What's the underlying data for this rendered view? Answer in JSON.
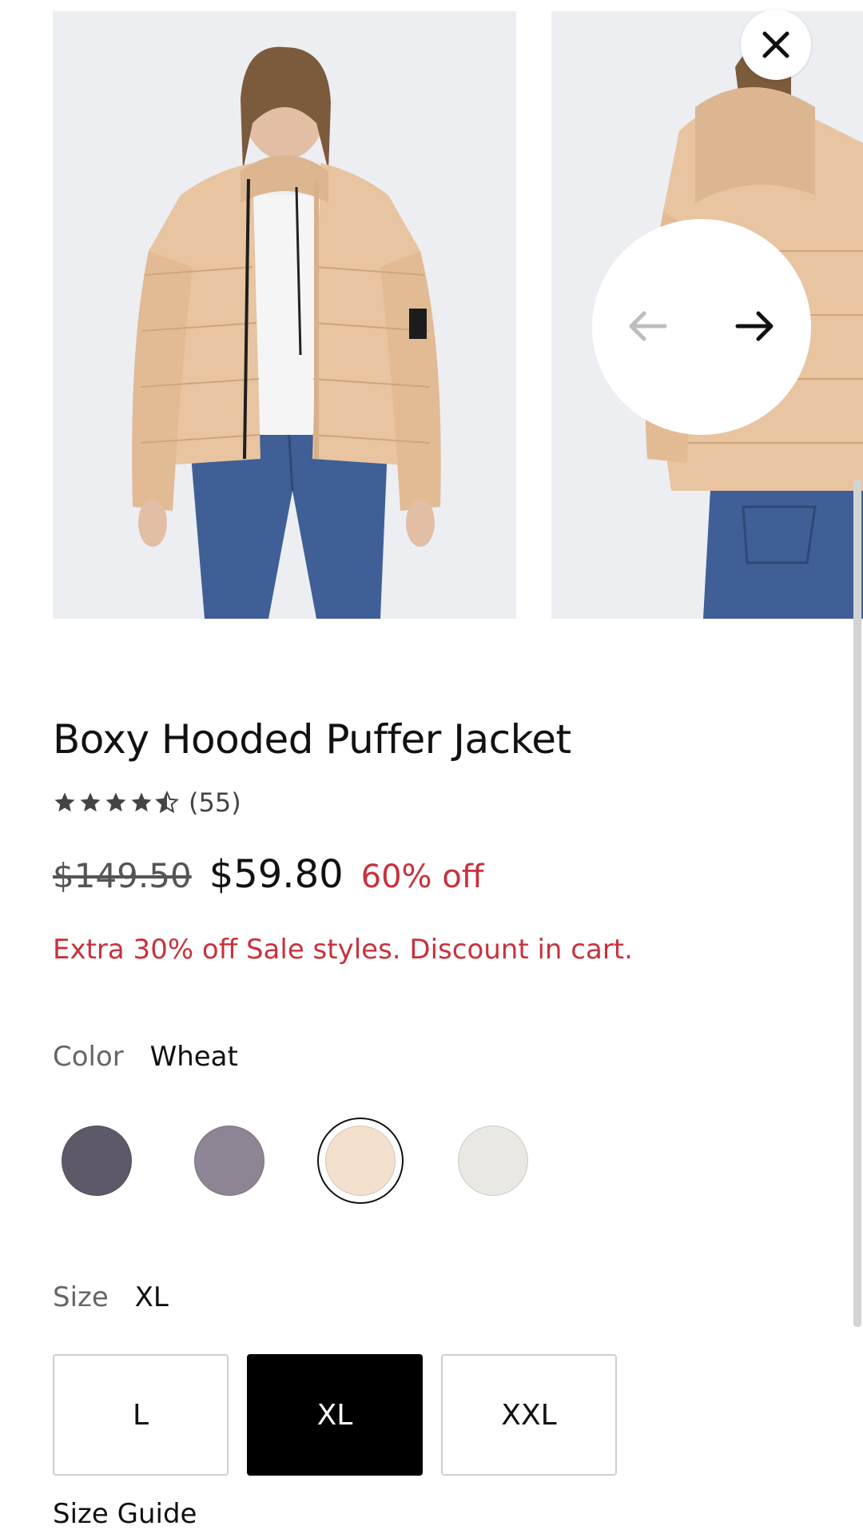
{
  "product": {
    "title": "Boxy Hooded Puffer Jacket",
    "rating_stars": 4.5,
    "review_count": "(55)",
    "price_original": "$149.50",
    "price_sale": "$59.80",
    "discount": "60% off",
    "promo": "Extra 30% off Sale styles. Discount in cart."
  },
  "gallery": {
    "images": [
      {
        "alt": "model-front"
      },
      {
        "alt": "model-back"
      }
    ],
    "prev_icon": "arrow-left-icon",
    "next_icon": "arrow-right-icon",
    "close_icon": "close-icon"
  },
  "color": {
    "label": "Color",
    "selected": "Wheat",
    "swatches": [
      {
        "hex": "#5e5969"
      },
      {
        "hex": "#8d8593"
      },
      {
        "hex": "#f3e1cd",
        "selected": true
      },
      {
        "hex": "#e9e8e3"
      }
    ]
  },
  "size": {
    "label": "Size",
    "selected": "XL",
    "options": [
      "L",
      "XL",
      "XXL"
    ],
    "guide": "Size Guide"
  },
  "colors": {
    "accent_red": "#c8323c",
    "selected_bg": "#000000"
  }
}
